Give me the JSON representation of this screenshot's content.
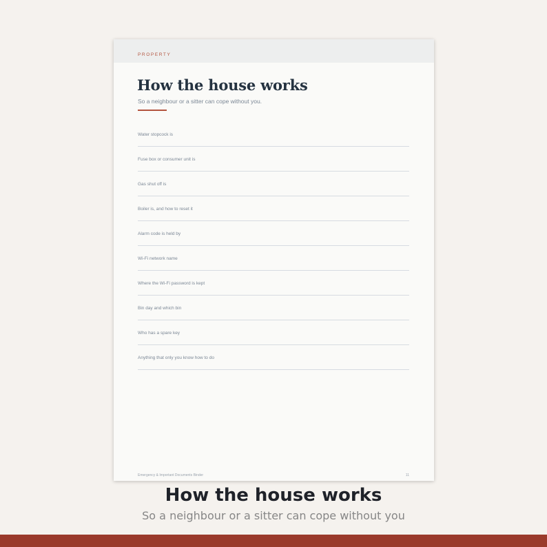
{
  "page": {
    "section_tag": "PROPERTY",
    "title": "How the house works",
    "subtitle": "So a neighbour or a sitter can cope without you.",
    "fields": [
      "Water stopcock is",
      "Fuse box or consumer unit is",
      "Gas shut off is",
      "Boiler is, and how to reset it",
      "Alarm code is held by",
      "Wi-Fi network name",
      "Where the Wi-Fi password is kept",
      "Bin day and which bin",
      "Who has a spare key",
      "Anything that only you know how to do"
    ],
    "footer": {
      "document_name": "Emergency & Important Documents Binder",
      "page_number": "11"
    }
  },
  "caption": {
    "title": "How the house works",
    "subtitle": "So a neighbour or a sitter can cope without you"
  },
  "colors": {
    "background": "#f5f2ee",
    "accent": "#b2533d",
    "heading": "#243240",
    "band": "#9a3a2b"
  }
}
